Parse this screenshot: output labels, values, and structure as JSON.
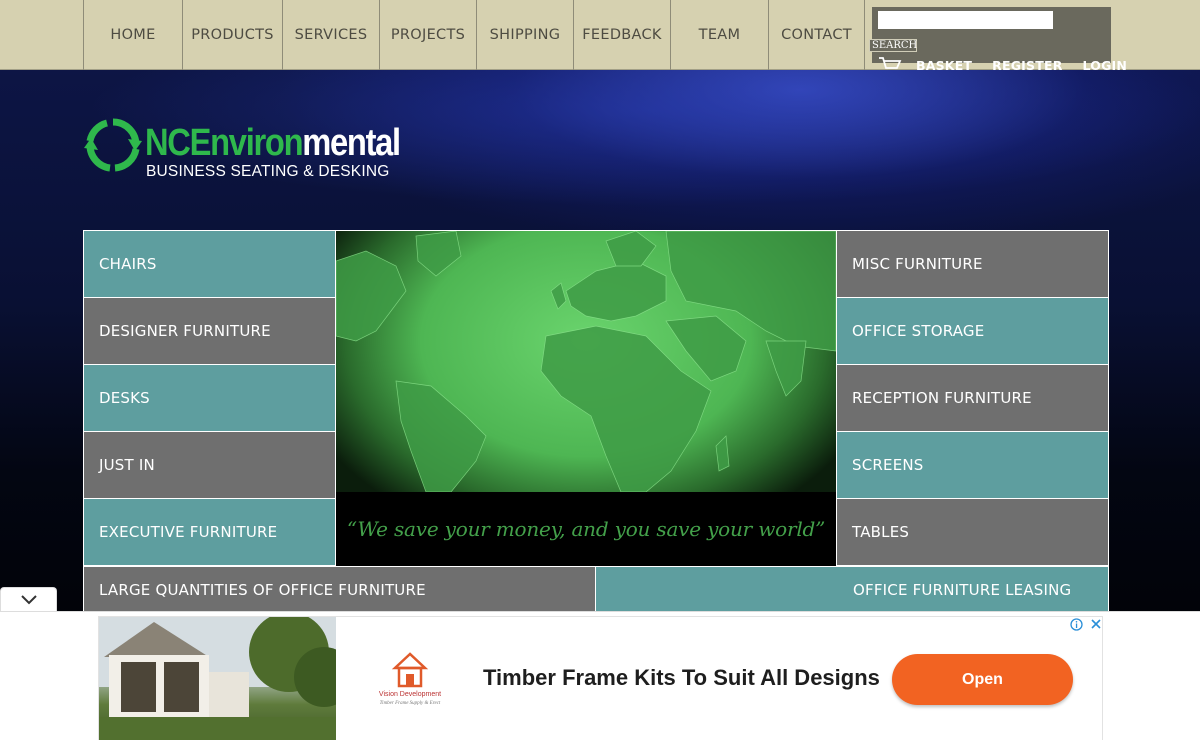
{
  "nav": {
    "items": [
      "HOME",
      "PRODUCTS",
      "SERVICES",
      "PROJECTS",
      "SHIPPING",
      "FEEDBACK",
      "TEAM",
      "CONTACT"
    ]
  },
  "search": {
    "input_value": "",
    "button_label": "SEARCH"
  },
  "user_links": {
    "basket": "BASKET",
    "register": "REGISTER",
    "login": "LOGIN"
  },
  "logo": {
    "title_part1": "NC",
    "title_part2": "Environ",
    "title_part3": "mental",
    "subtitle": "BUSINESS SEATING & DESKING"
  },
  "categories": {
    "left": [
      "CHAIRS",
      "DESIGNER FURNITURE",
      "DESKS",
      "JUST IN",
      "EXECUTIVE FURNITURE"
    ],
    "right": [
      "MISC FURNITURE",
      "OFFICE STORAGE",
      "RECEPTION FURNITURE",
      "SCREENS",
      "TABLES"
    ],
    "bottom_left": "LARGE QUANTITIES OF OFFICE FURNITURE",
    "bottom_right": "OFFICE FURNITURE LEASING"
  },
  "quote": "“We save your money, and you save your world”",
  "ad": {
    "logo_name": "Vision Development",
    "logo_tagline": "Timber Frame Supply & Erect",
    "headline": "Timber Frame Kits To Suit All Designs",
    "cta": "Open"
  },
  "colors": {
    "topbar": "#d6d1b0",
    "teal": "#5e9e9f",
    "grey": "#6f6f6f",
    "logo_green": "#2fb84c",
    "ad_button": "#f26322"
  }
}
